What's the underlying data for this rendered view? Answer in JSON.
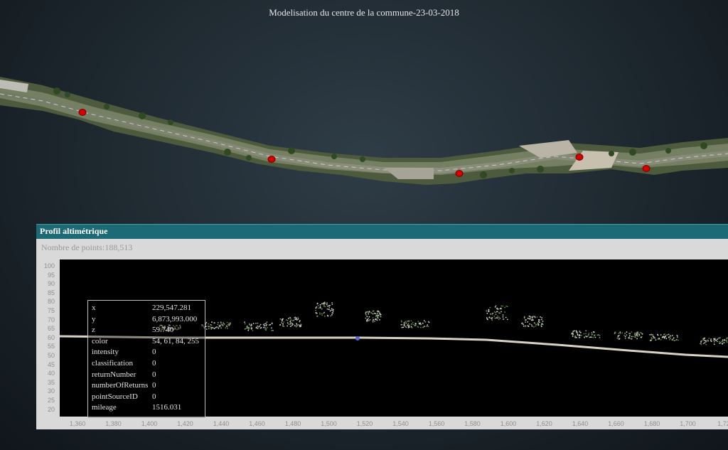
{
  "scene": {
    "title": "Modelisation du centre de la commune-23-03-2018"
  },
  "profile": {
    "header": "Profil altimétrique",
    "points_label": "Nombre de points:",
    "points_value": "188,513",
    "y_ticks": [
      "100",
      "95",
      "90",
      "85",
      "80",
      "75",
      "70",
      "65",
      "60",
      "55",
      "50",
      "45",
      "40",
      "35",
      "30",
      "25",
      "20"
    ],
    "x_ticks": [
      "1,360",
      "1,380",
      "1,400",
      "1,420",
      "1,440",
      "1,460",
      "1,480",
      "1,500",
      "1,520",
      "1,540",
      "1,560",
      "1,580",
      "1,600",
      "1,620",
      "1,640",
      "1,660",
      "1,680",
      "1,700",
      "1,72"
    ],
    "info": [
      {
        "key": "x",
        "value": "229,547.281"
      },
      {
        "key": "y",
        "value": "6,873,993.000"
      },
      {
        "key": "z",
        "value": "59.740"
      },
      {
        "key": "color",
        "value": "54, 61, 84, 255"
      },
      {
        "key": "intensity",
        "value": "0"
      },
      {
        "key": "classification",
        "value": "0"
      },
      {
        "key": "returnNumber",
        "value": "0"
      },
      {
        "key": "numberOfReturns",
        "value": "0"
      },
      {
        "key": "pointSourceID",
        "value": "0"
      },
      {
        "key": "mileage",
        "value": "1516.031"
      }
    ]
  },
  "colors": {
    "header_bg": "#1b6a75",
    "marker": "#d40000",
    "selected_point": "#5a6bd6"
  },
  "markers": [
    "survey-marker-1",
    "survey-marker-2",
    "survey-marker-3",
    "survey-marker-4",
    "survey-marker-5"
  ]
}
